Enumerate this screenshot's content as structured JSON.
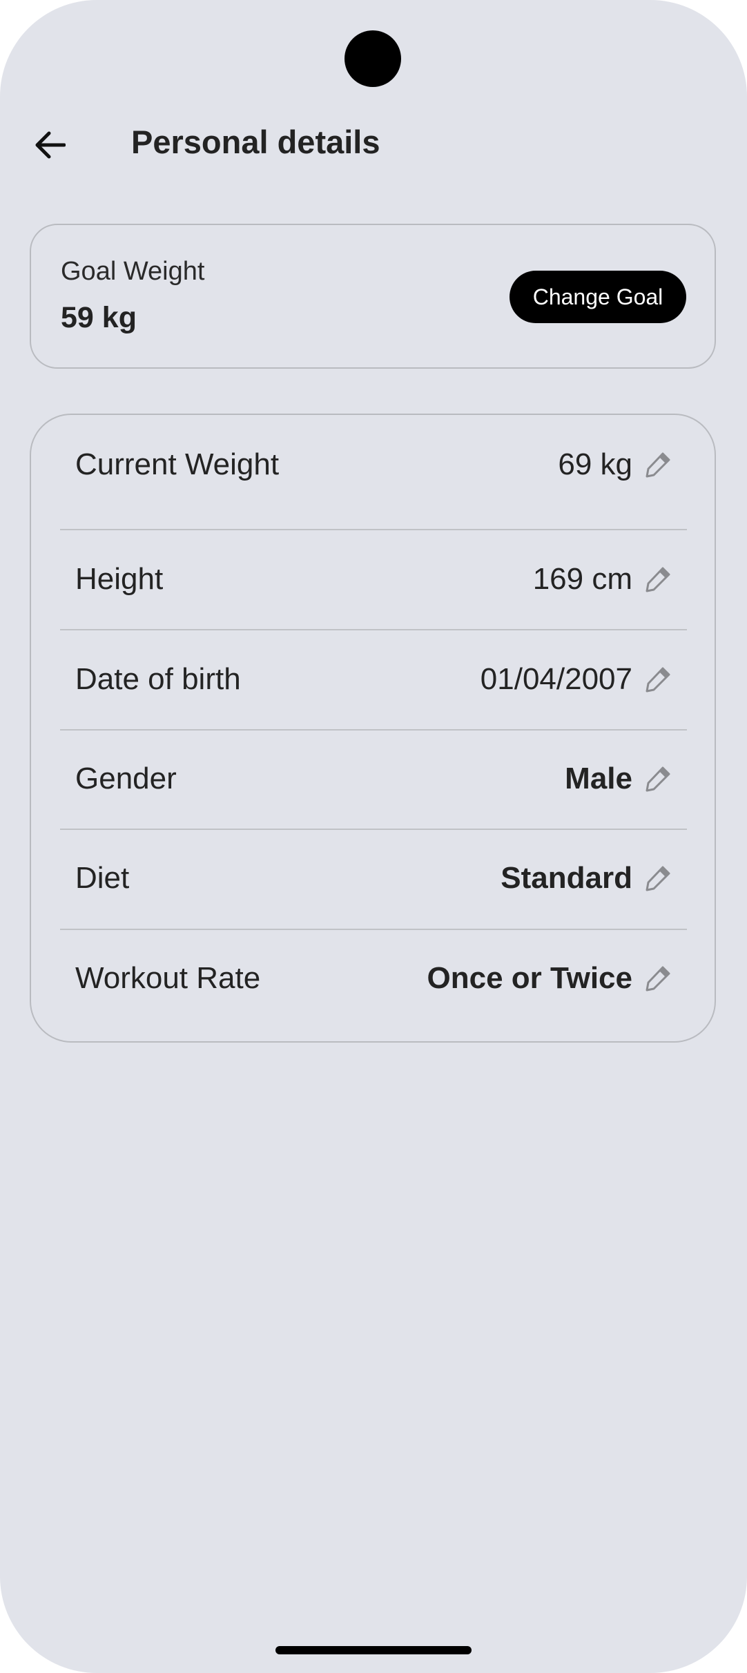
{
  "header": {
    "title": "Personal details",
    "back_icon": "arrow-left-icon"
  },
  "goal": {
    "label": "Goal Weight",
    "value": "59 kg",
    "button_label": "Change Goal"
  },
  "details": [
    {
      "label": "Current Weight",
      "value": "69 kg"
    },
    {
      "label": "Height",
      "value": "169 cm"
    },
    {
      "label": "Date of birth",
      "value": "01/04/2007"
    },
    {
      "label": "Gender",
      "value": "Male"
    },
    {
      "label": "Diet",
      "value": "Standard"
    },
    {
      "label": "Workout Rate",
      "value": "Once or Twice"
    }
  ],
  "icons": {
    "edit": "pencil-icon"
  },
  "colors": {
    "background": "#e1e3ea",
    "text": "#232323",
    "button": "#000000",
    "button_text": "#ffffff",
    "border": "#b9bbc0",
    "icon": "#8a8b8f"
  }
}
